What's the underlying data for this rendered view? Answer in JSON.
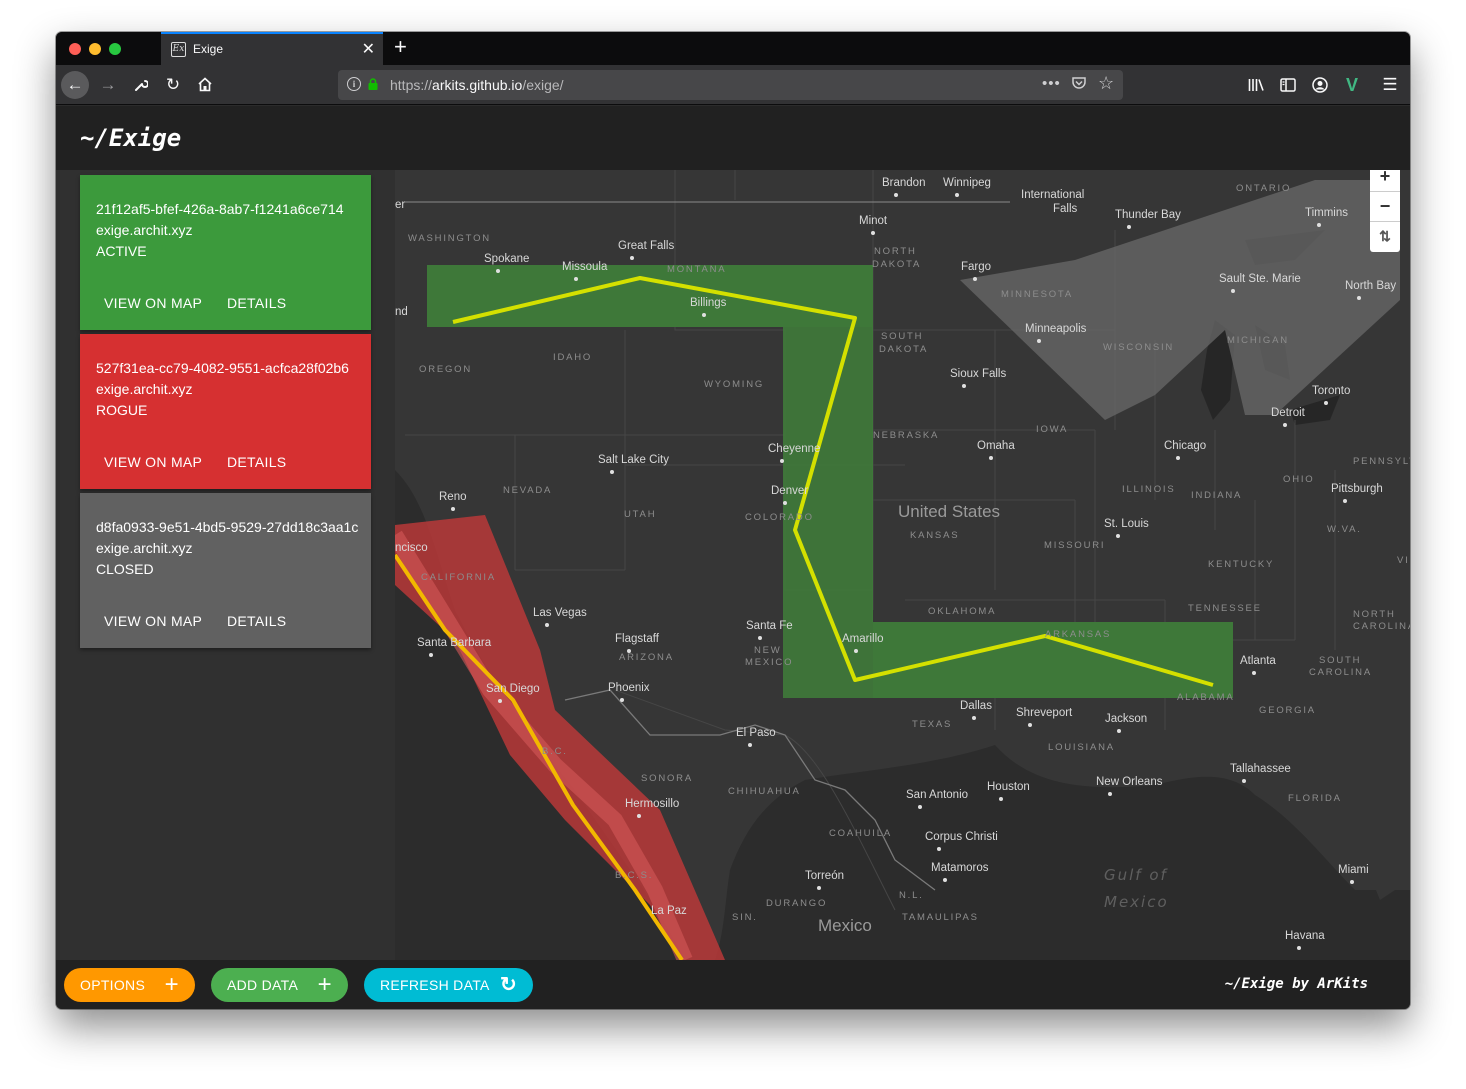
{
  "browser": {
    "tab_title": "Exige",
    "favicon_text": "Ex",
    "url_scheme": "https://",
    "url_host": "arkits.github.io",
    "url_path": "/exige/"
  },
  "app": {
    "brand": "~/Exige",
    "credit": "~/Exige by ArKits"
  },
  "sessions": [
    {
      "id": "21f12af5-bfef-426a-8ab7-f1241a6ce714",
      "host": "exige.archit.xyz",
      "status": "ACTIVE",
      "color": "#3c9a3c",
      "view_label": "VIEW ON MAP",
      "details_label": "DETAILS"
    },
    {
      "id": "527f31ea-cc79-4082-9551-acfca28f02b6",
      "host": "exige.archit.xyz",
      "status": "ROGUE",
      "color": "#d63031",
      "view_label": "VIEW ON MAP",
      "details_label": "DETAILS"
    },
    {
      "id": "d8fa0933-9e51-4bd5-9529-27dd18c3aa1c",
      "host": "exige.archit.xyz",
      "status": "CLOSED",
      "color": "#616161",
      "view_label": "VIEW ON MAP",
      "details_label": "DETAILS"
    }
  ],
  "map": {
    "zoom_in": "+",
    "zoom_out": "−",
    "compass": "⇅",
    "country_labels": [
      "United States",
      "Mexico"
    ],
    "water_labels": [
      "Gulf of",
      "Mexico"
    ],
    "region_labels": [
      "WASHINGTON",
      "MONTANA",
      "NORTH",
      "DAKOTA",
      "SOUTH",
      "DAKOTA",
      "MINNESOTA",
      "WISCONSIN",
      "MICHIGAN",
      "ONTARIO",
      "OREGON",
      "IDAHO",
      "WYOMING",
      "NEBRASKA",
      "IOWA",
      "NEVADA",
      "UTAH",
      "COLORADO",
      "KANSAS",
      "MISSOURI",
      "ILLINOIS",
      "INDIANA",
      "OHIO",
      "PENNSYLV",
      "W.VA.",
      "VIRGINI",
      "KENTUCKY",
      "TENNESSEE",
      "NORTH",
      "CAROLINA",
      "SOUTH",
      "CAROLINA",
      "CALIFORNIA",
      "ARIZONA",
      "NEW",
      "MEXICO",
      "OKLAHOMA",
      "ARKANSAS",
      "TEXAS",
      "LOUISIANA",
      "GEORGIA",
      "ALABAMA",
      "FLORIDA",
      "SONORA",
      "CHIHUAHUA",
      "COAHUILA",
      "DURANGO",
      "N.L.",
      "TAMAULIPAS",
      "SIN.",
      "B.C.",
      "B.C.S."
    ],
    "city_labels": [
      "Brandon",
      "Winnipeg",
      "International",
      "Falls",
      "Thunder Bay",
      "Timmins",
      "Minot",
      "Great Falls",
      "Spokane",
      "Missoula",
      "Billings",
      "Fargo",
      "Sault Ste. Marie",
      "North Bay",
      "Minneapolis",
      "Sioux Falls",
      "Toronto",
      "Detroit",
      "Chicago",
      "Omaha",
      "Cheyenne",
      "Salt Lake City",
      "Denver",
      "Reno",
      "Pittsburgh",
      "St. Louis",
      "ncisco",
      "Las Vegas",
      "Santa Fe",
      "Flagstaff",
      "Amarillo",
      "Santa Barbara",
      "Phoenix",
      "San Diego",
      "Atlanta",
      "Dallas",
      "Shreveport",
      "Jackson",
      "El Paso",
      "Hermosillo",
      "San Antonio",
      "Houston",
      "New Orleans",
      "Tallahassee",
      "Corpus Christi",
      "Matamoros",
      "Torreón",
      "Miami",
      "La Paz",
      "Havana",
      "nd",
      "er"
    ]
  },
  "footer": {
    "options_label": "OPTIONS",
    "options_color": "#ff9800",
    "add_label": "ADD DATA",
    "add_color": "#4caf50",
    "refresh_label": "REFRESH DATA",
    "refresh_color": "#00bcd4"
  }
}
